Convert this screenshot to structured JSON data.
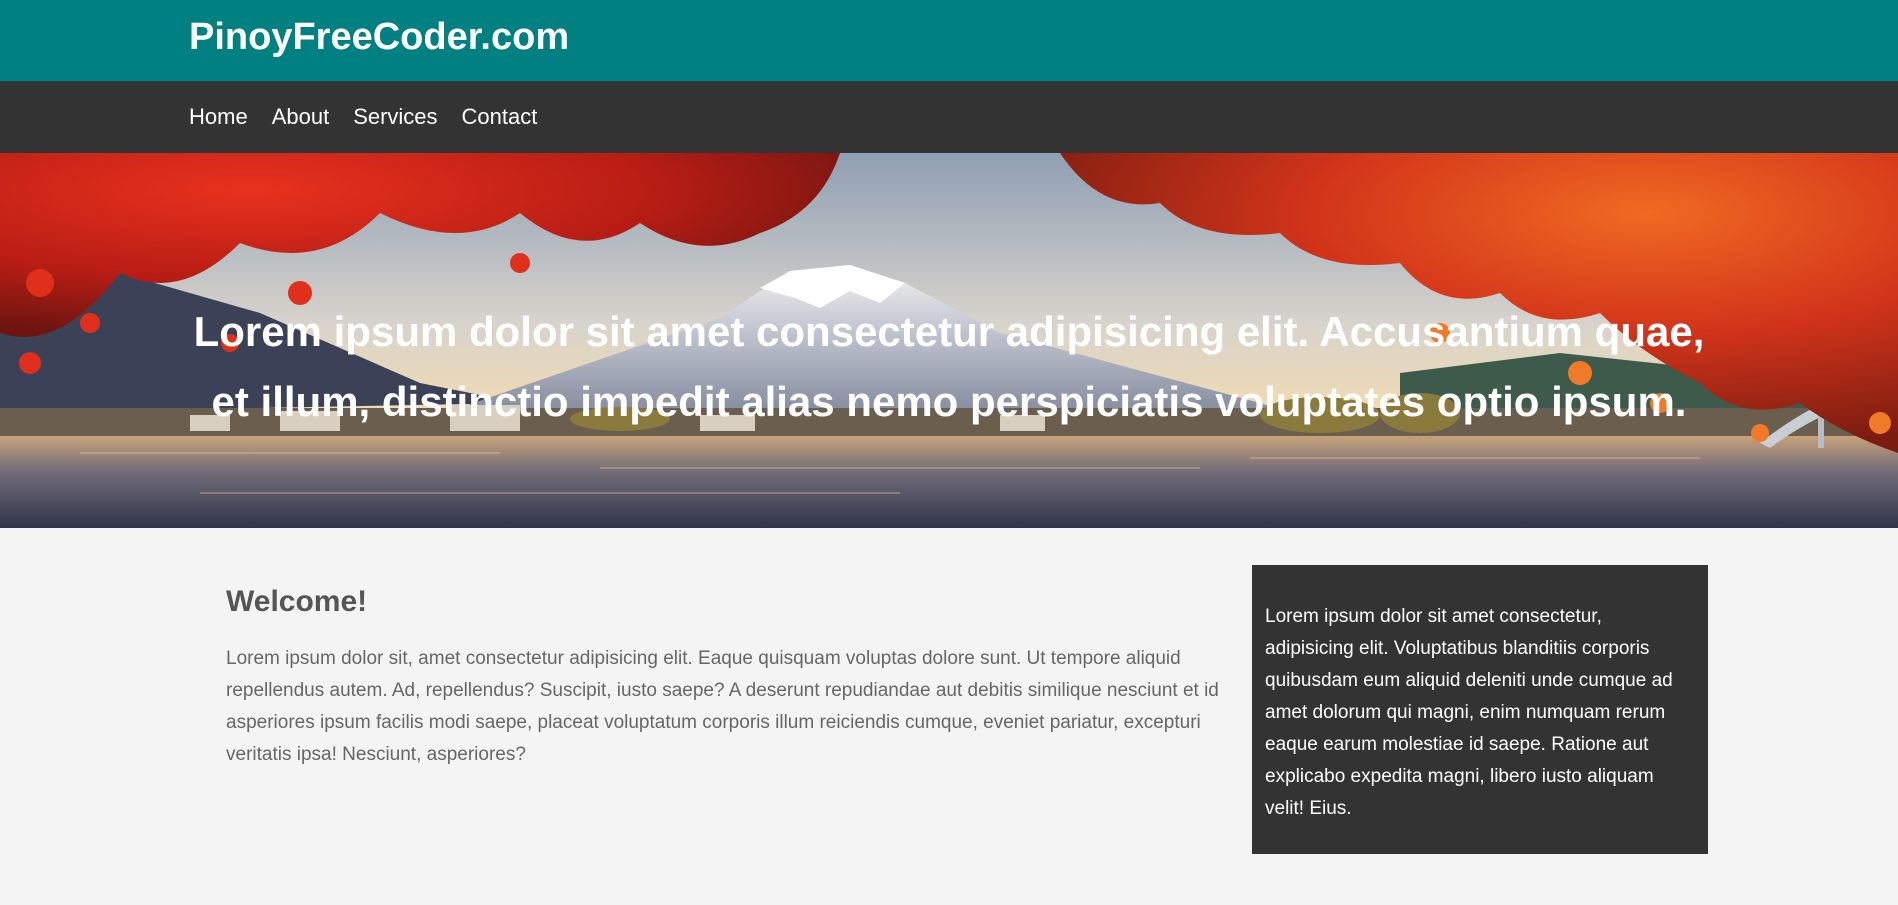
{
  "header": {
    "brand": "PinoyFreeCoder.com"
  },
  "nav": {
    "items": [
      {
        "label": "Home"
      },
      {
        "label": "About"
      },
      {
        "label": "Services"
      },
      {
        "label": "Contact"
      }
    ]
  },
  "hero": {
    "text": "Lorem ipsum dolor sit amet consectetur adipisicing elit. Accusantium quae, et illum, distinctio impedit alias nemo perspiciatis voluptates optio ipsum."
  },
  "main": {
    "heading": "Welcome!",
    "paragraph": "Lorem ipsum dolor sit, amet consectetur adipisicing elit. Eaque quisquam voluptas dolore sunt. Ut tempore aliquid repellendus autem. Ad, repellendus? Suscipit, iusto saepe? A deserunt repudiandae aut debitis similique nesciunt et id asperiores ipsum facilis modi saepe, placeat voluptatum corporis illum reiciendis cumque, eveniet pariatur, excepturi veritatis ipsa! Nesciunt, asperiores?"
  },
  "sidebar": {
    "text": "Lorem ipsum dolor sit amet consectetur, adipisicing elit. Voluptatibus blanditiis corporis quibusdam eum aliquid deleniti unde cumque ad amet dolorum qui magni, enim numquam rerum eaque earum molestiae id saepe. Ratione aut explicabo expedita magni, libero iusto aliquam velit! Eius."
  },
  "colors": {
    "header_bg": "#008080",
    "nav_bg": "#333333",
    "page_bg": "#f4f4f4",
    "sidebar_bg": "#333333"
  }
}
